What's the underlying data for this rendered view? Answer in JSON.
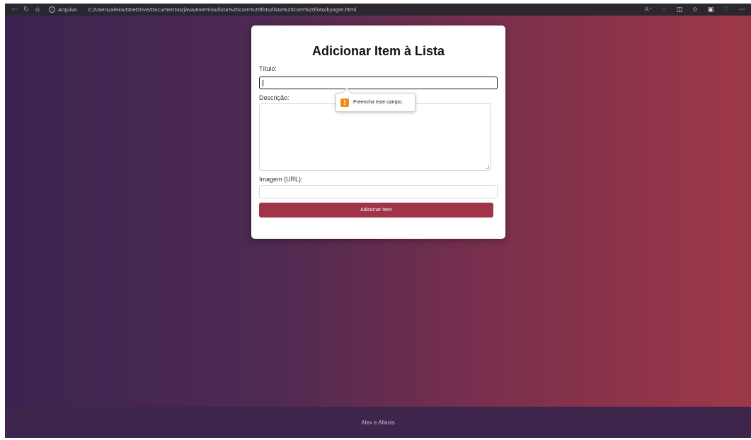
{
  "browser": {
    "site_label": "Arquivo",
    "url": "C:/Users/alexa/OneDrive/Documentos/java/exemlos/lista%20com%20foto/lista%20com%20foto/kyogre.html"
  },
  "form": {
    "title": "Adicionar Item à Lista",
    "title_label": "Título:",
    "title_value": "",
    "description_label": "Descrição:",
    "description_value": "",
    "image_label": "Imagem (URL):",
    "image_value": "",
    "submit_label": "Adicionar Item"
  },
  "validation": {
    "message": "Preencha este campo.",
    "icon": "warning-icon",
    "icon_glyph": "!"
  },
  "footer": {
    "text": "Alex e Allanis"
  },
  "colors": {
    "gradient_start": "#3c2450",
    "gradient_end": "#9e3848",
    "button": "#a03547",
    "footer": "#3d254b",
    "warning": "#f28c1c"
  }
}
